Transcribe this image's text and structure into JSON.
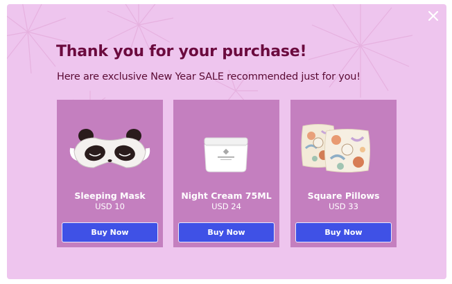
{
  "popup": {
    "title": "Thank you for your purchase!",
    "subtitle": "Here are exclusive New Year SALE recommended just for you!",
    "close_icon": "close-icon"
  },
  "colors": {
    "background": "#eec5ee",
    "card": "#c47fbf",
    "title": "#6b0a3e",
    "button": "#3f51e6"
  },
  "products": [
    {
      "name": "Sleeping Mask",
      "price": "USD 10",
      "button_label": "Buy Now",
      "image": "sleeping-mask-image"
    },
    {
      "name": "Night Cream 75ML",
      "price": "USD 24",
      "button_label": "Buy Now",
      "image": "night-cream-image"
    },
    {
      "name": "Square Pillows",
      "price": "USD 33",
      "button_label": "Buy Now",
      "image": "square-pillows-image"
    }
  ]
}
